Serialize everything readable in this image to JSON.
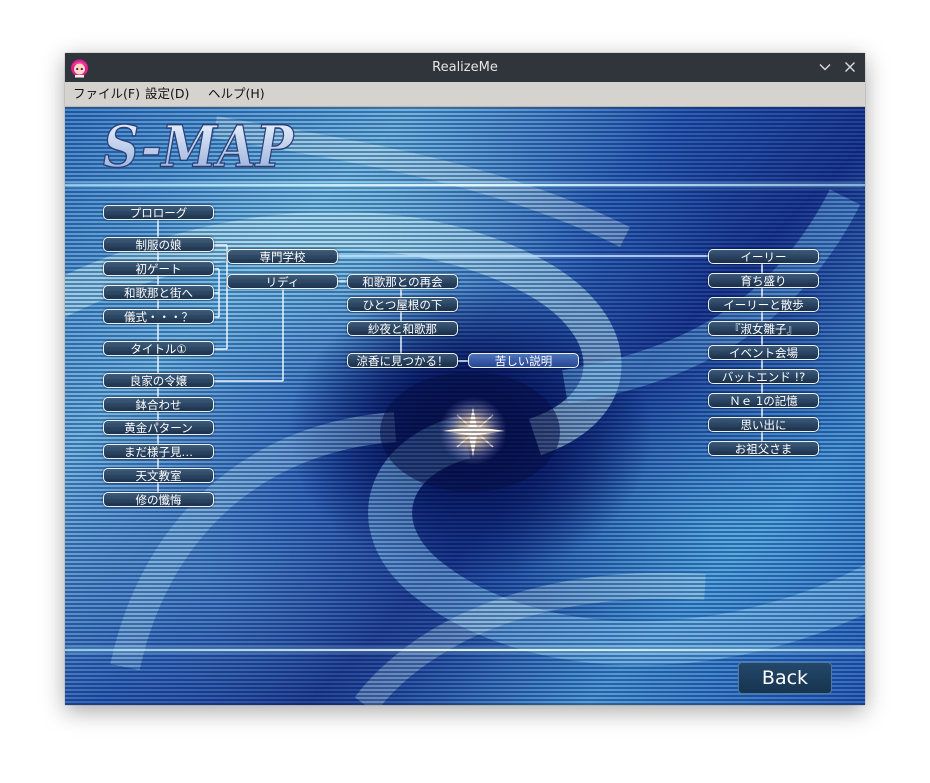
{
  "window": {
    "title": "RealizeMe",
    "controls": {
      "minimize_icon": "chevron-down-icon",
      "close_icon": "close-icon"
    }
  },
  "menu": {
    "file": "ファイル(F)",
    "settings": "設定(D)",
    "help": "ヘルプ(H)"
  },
  "screen": {
    "logo": "S-MAP",
    "back_label": "Back"
  },
  "map": {
    "left_column": [
      "プロローグ",
      "制服の娘",
      "初ゲート",
      "和歌那と街へ",
      "儀式・・・？",
      "タイトル①",
      "良家の令嬢",
      "鉢合わせ",
      "黄金パターン",
      "まだ様子見…",
      "天文教室",
      "修の懺悔"
    ],
    "branch_school": "専門学校",
    "branch_lidy": "リディ",
    "lidy_route": [
      "和歌那との再会",
      "ひとつ屋根の下",
      "紗夜と和歌那",
      "涼香に見つかる！"
    ],
    "side_event": "苦しい説明",
    "right_column": [
      "イーリー",
      "育ち盛り",
      "イーリーと散歩",
      "『淑女雛子』",
      "イベント会場",
      "バットエンド !?",
      "Ｎｅ 1の記憶",
      "思い出に",
      "お祖父さま"
    ]
  }
}
